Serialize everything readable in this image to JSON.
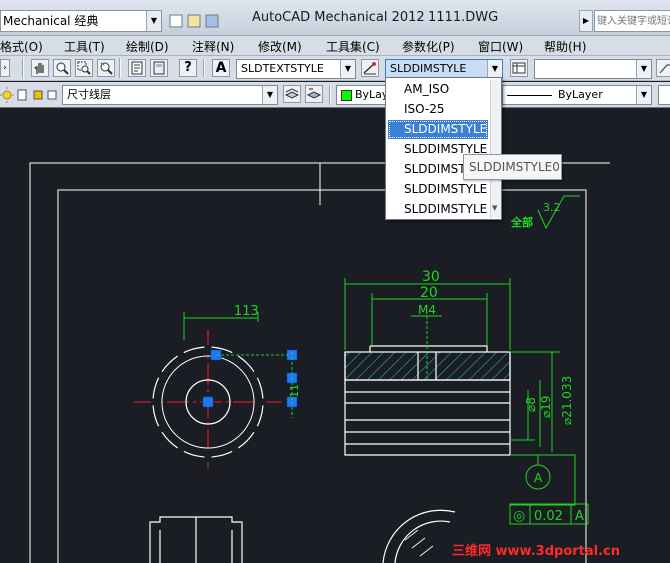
{
  "titlebar": {
    "workspace": "Mechanical 经典",
    "app_title": "AutoCAD Mechanical 2012",
    "file_name": "1111.DWG",
    "search_placeholder": "键入关键字或短语"
  },
  "menus": [
    "格式(O)",
    "工具(T)",
    "绘制(D)",
    "注释(N)",
    "修改(M)",
    "工具集(C)",
    "参数化(P)",
    "窗口(W)",
    "帮助(H)"
  ],
  "toolbar1": {
    "text_style": "SLDTEXTSTYLE",
    "dim_style": "SLDDIMSTYLE",
    "table_style": ""
  },
  "toolbar2": {
    "layer": "尺寸线层",
    "color": "ByLayer",
    "linetype": "ByLayer"
  },
  "dropdown": {
    "options": [
      "AM_ISO",
      "ISO-25",
      "SLDDIMSTYLE",
      "SLDDIMSTYLE",
      "SLDDIMSTYLE",
      "SLDDIMSTYLE",
      "SLDDIMSTYLE"
    ],
    "selected_index": 2,
    "tooltip": "SLDDIMSTYLE0"
  },
  "drawing": {
    "dims": {
      "d113": "113",
      "d30": "30",
      "d20": "20",
      "m4": "M4",
      "d8": "⌀8",
      "d19": "⌀19",
      "d21": "⌀21.033",
      "d11": "11"
    },
    "datum": "A",
    "roughness": "3.2",
    "roughness_label": "全部",
    "tolerance": {
      "symbol": "◎",
      "value": "0.02",
      "datum": "A"
    }
  },
  "watermark": "三维网 www.3dportal.cn",
  "colors": {
    "accent": "#3b7fd6",
    "canvas": "#1a1d23",
    "dim_green": "#22d422",
    "frame_white": "#ffffff",
    "axis_red": "#ff2020",
    "grip_blue": "#1e78ff",
    "hatch_cyan": "#22c8c8"
  }
}
